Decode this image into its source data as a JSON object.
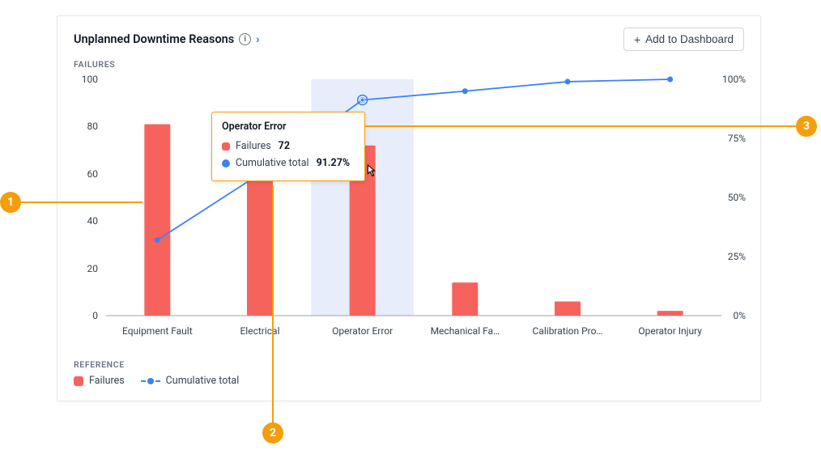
{
  "header": {
    "title": "Unplanned Downtime Reasons",
    "add_button": "Add to Dashboard"
  },
  "labels": {
    "failures": "FAILURES",
    "reference": "REFERENCE"
  },
  "legend": {
    "failures": "Failures",
    "cumulative": "Cumulative total"
  },
  "tooltip": {
    "title": "Operator Error",
    "failures_label": "Failures",
    "failures_value": "72",
    "cumulative_label": "Cumulative total",
    "cumulative_value": "91.27%"
  },
  "callouts": {
    "c1": "1",
    "c2": "2",
    "c3": "3"
  },
  "chart_data": {
    "type": "bar",
    "categories": [
      "Equipment Fault",
      "Electrical",
      "Operator Error",
      "Mechanical Fa…",
      "Calibration Pro…",
      "Operator Injury"
    ],
    "series": [
      {
        "name": "Failures",
        "type": "bar",
        "values": [
          81,
          60,
          72,
          14,
          6,
          2
        ]
      },
      {
        "name": "Cumulative total",
        "type": "line",
        "values_pct": [
          32,
          60,
          91.27,
          95,
          99,
          100
        ]
      }
    ],
    "ylabel": "FAILURES",
    "ylim_left": [
      0,
      100
    ],
    "y_ticks_left": [
      0,
      20,
      40,
      60,
      80,
      100
    ],
    "ylim_right_pct": [
      0,
      100
    ],
    "y_ticks_right": [
      "0%",
      "25%",
      "50%",
      "75%",
      "100%"
    ],
    "highlighted_category": "Operator Error"
  }
}
